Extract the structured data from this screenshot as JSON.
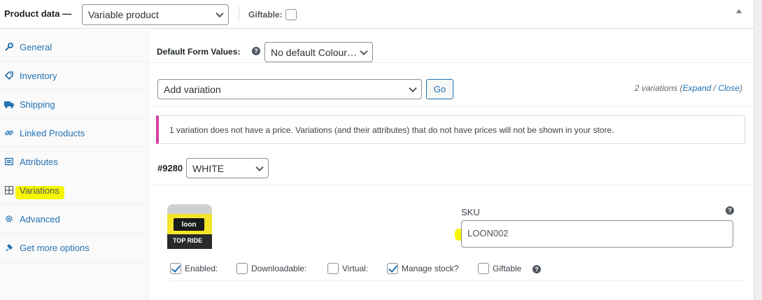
{
  "header": {
    "title": "Product data —",
    "product_type": "Variable product",
    "giftable_label": "Giftable:"
  },
  "sidebar": {
    "items": [
      {
        "label": "General",
        "icon": "wrench-icon"
      },
      {
        "label": "Inventory",
        "icon": "tag-icon"
      },
      {
        "label": "Shipping",
        "icon": "truck-icon"
      },
      {
        "label": "Linked Products",
        "icon": "link-icon"
      },
      {
        "label": "Attributes",
        "icon": "list-icon"
      },
      {
        "label": "Variations",
        "icon": "grid-icon",
        "active": true
      },
      {
        "label": "Advanced",
        "icon": "gear-icon"
      },
      {
        "label": "Get more options",
        "icon": "plugin-icon"
      }
    ]
  },
  "main": {
    "default_form_values_label": "Default Form Values:",
    "default_colour": "No default Colour…",
    "add_variation": "Add variation",
    "go_label": "Go",
    "variation_count": "2 variations (",
    "expand_label": "Expand",
    "slash": " / ",
    "close_label": "Close",
    "close_paren": ")",
    "notice": "1 variation does not have a price. Variations (and their attributes) that do not have prices will not be shown in your store.",
    "variation": {
      "id": "#9280",
      "attribute_value": "WHITE",
      "sku_label": "SKU",
      "sku_value": "LOON002",
      "image_text_logo": "loon",
      "image_text_label": "TOP RIDE",
      "checkboxes": [
        {
          "label": "Enabled:",
          "checked": true
        },
        {
          "label": "Downloadable:",
          "checked": false
        },
        {
          "label": "Virtual:",
          "checked": false
        },
        {
          "label": "Manage stock?",
          "checked": true
        },
        {
          "label": "Giftable",
          "checked": false
        }
      ]
    }
  },
  "colors": {
    "link": "#2271b1",
    "notice_border": "#d63fa0",
    "highlight": "#f6f600"
  }
}
